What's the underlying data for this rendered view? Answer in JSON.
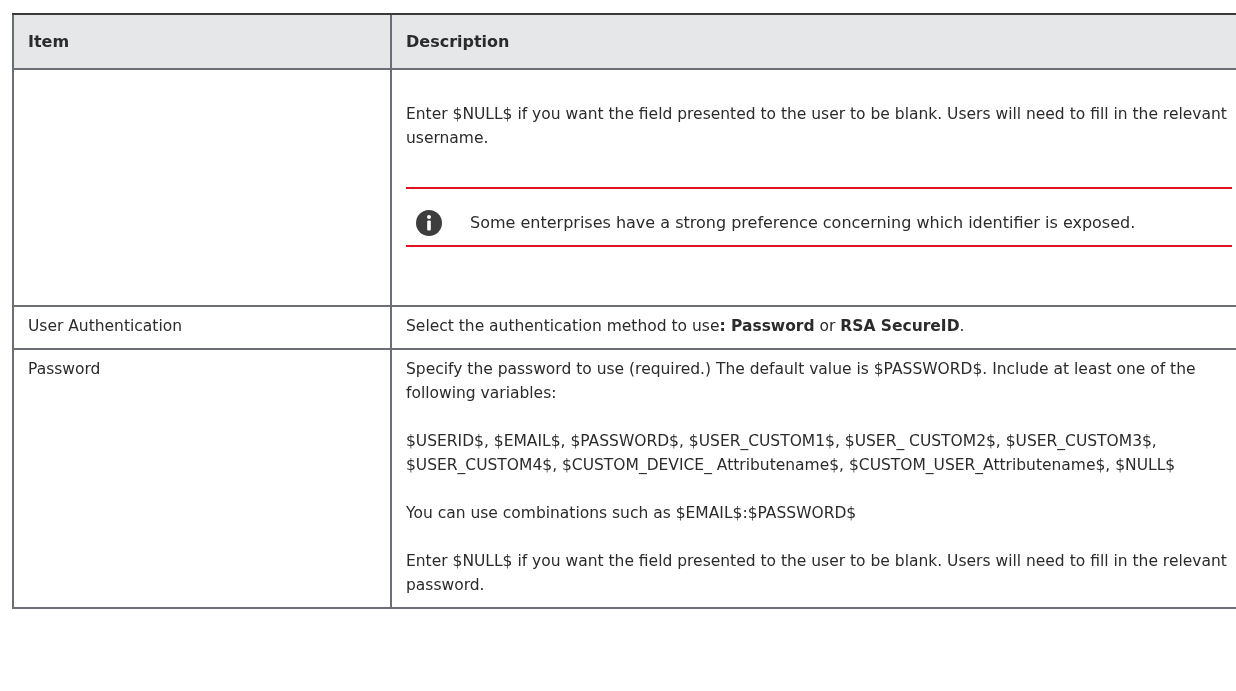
{
  "table": {
    "columns": [
      "Item",
      "Description"
    ],
    "rows": [
      {
        "description": [
          {
            "kind": "text",
            "text": "Enter $NULL$ if you want the field presented to the user to be blank. Users will need to fill in the relevant username."
          },
          {
            "kind": "note",
            "text": "Some enterprises have a strong preference concerning which identifier is exposed."
          }
        ]
      },
      {
        "item": "User Authentication",
        "description": [
          {
            "kind": "text",
            "text": "Select the authentication method to use**: Password** or **RSA SecureID**."
          }
        ]
      },
      {
        "item": "Password",
        "description": [
          {
            "kind": "text",
            "text": "Specify the password to use (required.) The default value is $PASSWORD$. Include at least one of the following variables:"
          },
          {
            "kind": "text",
            "text": "$USERID$, $EMAIL$, $PASSWORD$, $USER_CUSTOM1$, $USER_ CUSTOM2$, $USER_CUSTOM3$, $USER_CUSTOM4$, $CUSTOM_DEVICE_ Attributename$, $CUSTOM_USER_Attributename$, $NULL$"
          },
          {
            "kind": "text",
            "text": "You can use combinations such as $EMAIL$:$PASSWORD$"
          },
          {
            "kind": "text",
            "text": "Enter $NULL$ if you want the field presented to the user to be blank. Users will need to fill in the relevant password."
          }
        ]
      }
    ]
  }
}
